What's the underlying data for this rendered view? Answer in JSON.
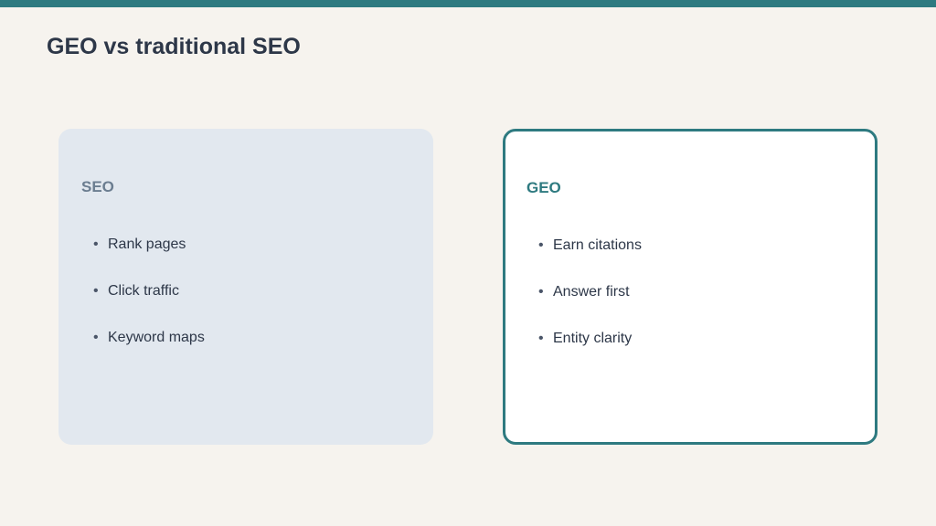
{
  "slide": {
    "title": "GEO vs traditional SEO"
  },
  "left_card": {
    "heading": "SEO",
    "items": [
      "Rank pages",
      "Click traffic",
      "Keyword maps"
    ]
  },
  "right_card": {
    "heading": "GEO",
    "items": [
      "Earn citations",
      "Answer first",
      "Entity clarity"
    ]
  },
  "colors": {
    "accent": "#2e7a80",
    "background": "#f6f3ee",
    "left_card_bg": "#e2e8ef",
    "right_card_bg": "#ffffff",
    "text": "#2d3748",
    "muted_heading": "#6b7d90"
  },
  "bullet_glyph": "•"
}
